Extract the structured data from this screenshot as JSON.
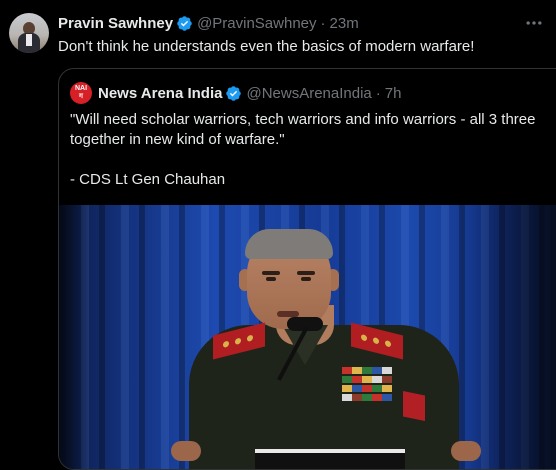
{
  "tweet": {
    "author_name": "Pravin Sawhney",
    "handle": "@PravinSawhney",
    "separator": "·",
    "time": "23m",
    "text": "Don't think he understands even the basics of modern warfare!"
  },
  "quoted_tweet": {
    "avatar_text_line1": "NAI",
    "avatar_text_line2": "ग",
    "author_name": "News Arena India",
    "handle": "@NewsArenaIndia",
    "separator": "·",
    "time": "7h",
    "text_line1": "\"Will need scholar warriors, tech warriors and info warriors - all 3 three",
    "text_line2": "together in new kind of warfare.\"",
    "text_line3": "- CDS Lt Gen Chauhan"
  },
  "icons": {
    "verified": "verified-badge-icon",
    "more": "more-options-icon"
  },
  "colors": {
    "background": "#000000",
    "text": "#e7e9ea",
    "secondary_text": "#71767b",
    "verified_blue": "#1d9bf0",
    "border": "#2f3336",
    "brand_red": "#d61f26"
  }
}
